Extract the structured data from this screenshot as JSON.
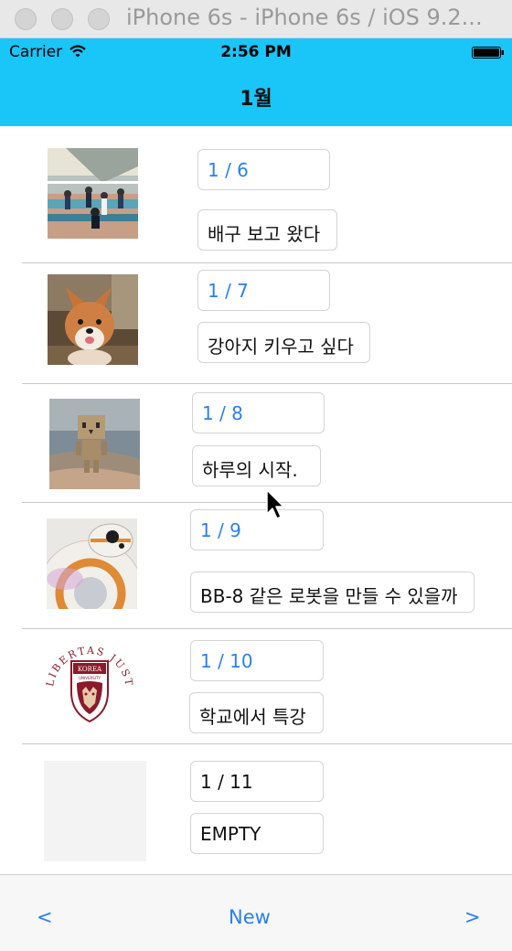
{
  "window": {
    "title": "iPhone 6s - iPhone 6s / iOS 9.2..."
  },
  "statusbar": {
    "carrier": "Carrier",
    "time": "2:56 PM"
  },
  "navbar": {
    "title": "1월"
  },
  "rows": [
    {
      "date": "1 / 6",
      "memo": "배구 보고 왔다",
      "image": "volleyball-photo"
    },
    {
      "date": "1 / 7",
      "memo": "강아지 키우고 싶다",
      "image": "corgi-puppy-photo"
    },
    {
      "date": "1 / 8",
      "memo": "하루의 시작.",
      "image": "danbo-figure-photo"
    },
    {
      "date": "1 / 9",
      "memo": "BB-8 같은 로봇을 만들 수 있을까",
      "image": "bb8-robot-photo"
    },
    {
      "date": "1 / 10",
      "memo": "학교에서 특강",
      "image": "korea-university-emblem"
    },
    {
      "date": "1 / 11",
      "memo": "EMPTY",
      "image": "empty-placeholder"
    }
  ],
  "emblem": {
    "arc_text": "LIBERTAS JUSTITIA VERITAS",
    "shield_top": "KOREA",
    "shield_sub": "UNIVERSITY"
  },
  "toolbar": {
    "prev": "<",
    "new": "New",
    "next": ">"
  },
  "colors": {
    "accent": "#1ac5f8",
    "link": "#2a7ff6",
    "emblem": "#8b1a2b"
  }
}
